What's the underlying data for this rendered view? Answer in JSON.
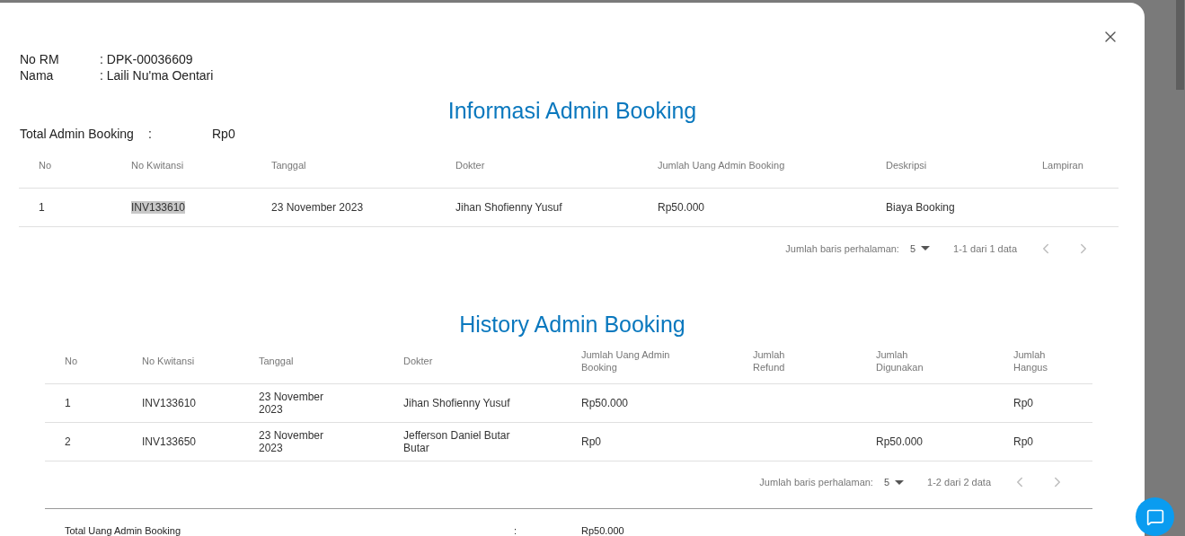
{
  "patient": [
    {
      "label": "No RM",
      "value": ": DPK-00036609"
    },
    {
      "label": "Nama",
      "value": ": Laili Nu'ma Oentari"
    }
  ],
  "info": {
    "title": "Informasi Admin Booking",
    "total_label": "Total Admin Booking",
    "total_colon": ":",
    "total_value": "Rp0",
    "columns": [
      "No",
      "No Kwitansi",
      "Tanggal",
      "Dokter",
      "Jumlah Uang Admin Booking",
      "Deskripsi",
      "Lampiran"
    ],
    "rows": [
      {
        "cells": [
          "1",
          "INV133610",
          "23 November 2023",
          "Jihan Shofienny Yusuf",
          "Rp50.000",
          "Biaya Booking",
          ""
        ],
        "receipt_highlighted": true
      }
    ],
    "pagination": {
      "rows_label": "Jumlah baris perhalaman:",
      "rows_value": "5",
      "range": "1-1 dari 1 data",
      "prev_disabled": true,
      "next_disabled": true
    }
  },
  "history": {
    "title": "History Admin Booking",
    "columns": [
      "No",
      "No Kwitansi",
      "Tanggal",
      "Dokter",
      "Jumlah Uang Admin Booking",
      "Jumlah Refund",
      "Jumlah Digunakan",
      "Jumlah Hangus"
    ],
    "rows": [
      {
        "cells": [
          "1",
          "INV133610",
          "23 November 2023",
          "Jihan Shofienny Yusuf",
          "Rp50.000",
          "",
          "",
          "Rp0"
        ]
      },
      {
        "cells": [
          "2",
          "INV133650",
          "23 November 2023",
          "Jefferson Daniel Butar Butar",
          "Rp0",
          "",
          "Rp50.000",
          "Rp0"
        ]
      }
    ],
    "pagination": {
      "rows_label": "Jumlah baris perhalaman:",
      "rows_value": "5",
      "range": "1-2 dari 2 data",
      "prev_disabled": true,
      "next_disabled": true
    },
    "total": {
      "label": "Total Uang Admin Booking",
      "colon": ":",
      "value": "Rp50.000"
    }
  }
}
